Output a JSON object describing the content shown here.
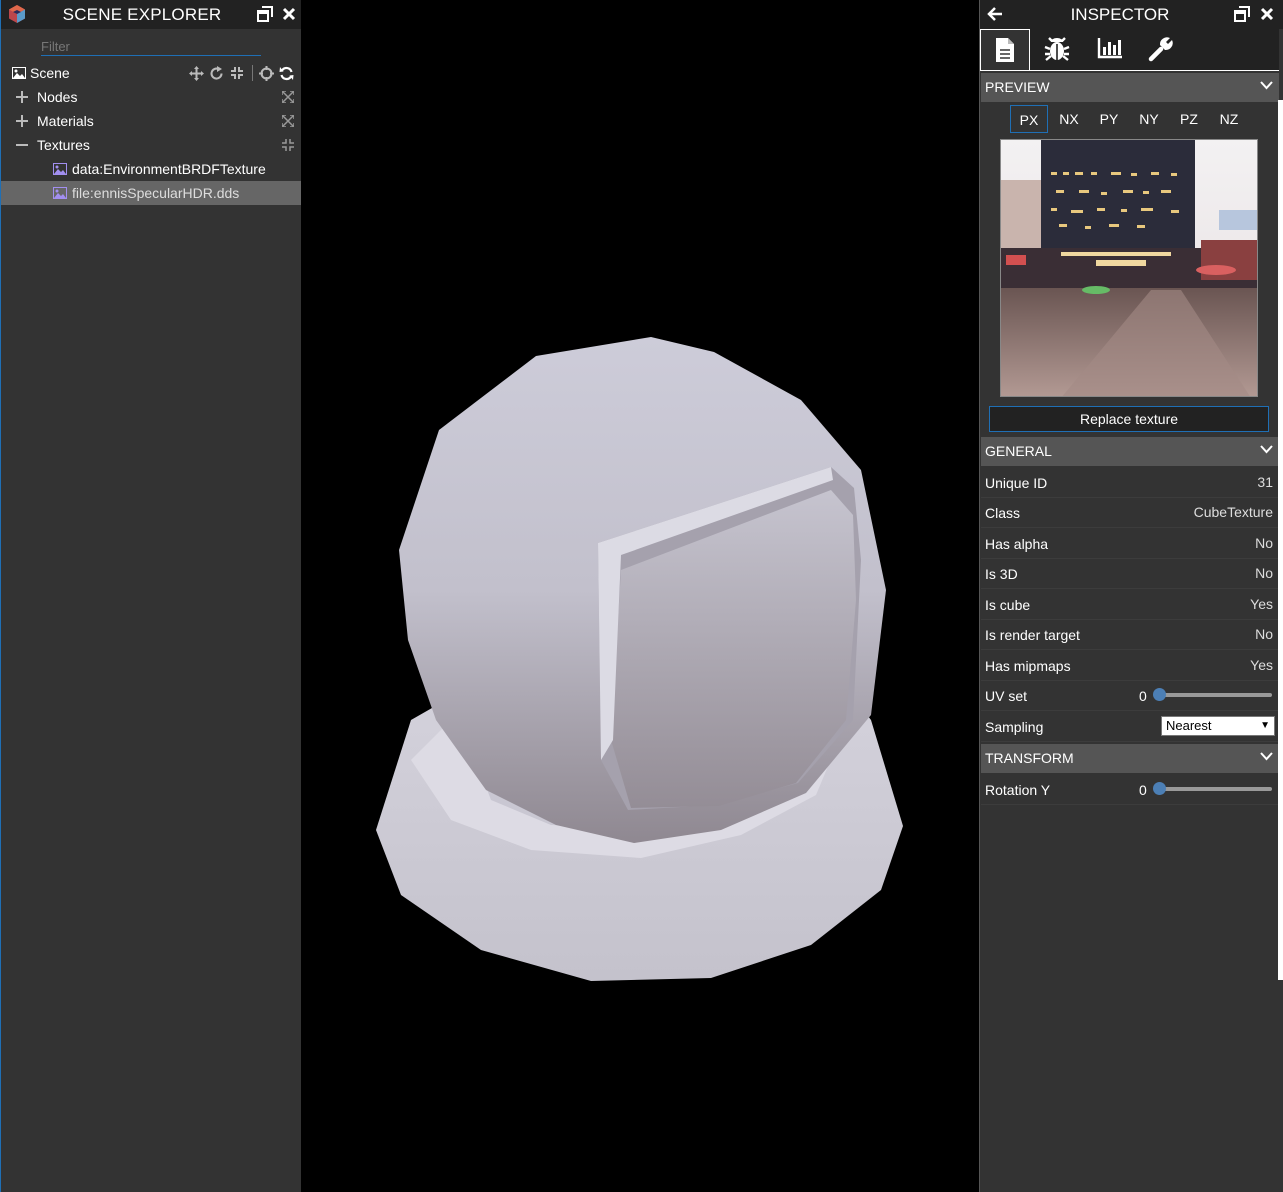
{
  "explorer": {
    "title": "SCENE EXPLORER",
    "filter_placeholder": "Filter",
    "scene_label": "Scene",
    "tree": [
      {
        "label": "Nodes",
        "expanded": false
      },
      {
        "label": "Materials",
        "expanded": false
      },
      {
        "label": "Textures",
        "expanded": true
      }
    ],
    "textures": [
      {
        "label": "data:EnvironmentBRDFTexture",
        "selected": false
      },
      {
        "label": "file:ennisSpecularHDR.dds",
        "selected": true
      }
    ]
  },
  "inspector": {
    "title": "INSPECTOR",
    "tabs": [
      {
        "icon": "document-icon",
        "active": true
      },
      {
        "icon": "bug-icon",
        "active": false
      },
      {
        "icon": "statistics-icon",
        "active": false
      },
      {
        "icon": "wrench-icon",
        "active": false
      }
    ],
    "preview": {
      "header": "PREVIEW",
      "faces": [
        "PX",
        "NX",
        "PY",
        "NY",
        "PZ",
        "NZ"
      ],
      "active_face": "PX",
      "replace_label": "Replace texture"
    },
    "general": {
      "header": "GENERAL",
      "rows": [
        {
          "label": "Unique ID",
          "value": "31"
        },
        {
          "label": "Class",
          "value": "CubeTexture"
        },
        {
          "label": "Has alpha",
          "value": "No"
        },
        {
          "label": "Is 3D",
          "value": "No"
        },
        {
          "label": "Is cube",
          "value": "Yes"
        },
        {
          "label": "Is render target",
          "value": "No"
        },
        {
          "label": "Has mipmaps",
          "value": "Yes"
        }
      ],
      "uv_set": {
        "label": "UV set",
        "value": "0"
      },
      "sampling": {
        "label": "Sampling",
        "value": "Nearest"
      }
    },
    "transform": {
      "header": "TRANSFORM",
      "rotation_y": {
        "label": "Rotation Y",
        "value": "0"
      }
    }
  },
  "colors": {
    "accent": "#1f6fb5",
    "panel": "#333333",
    "header": "#222222",
    "section": "#555555",
    "selected_row": "#666666",
    "slider_thumb": "#4c7fb5"
  }
}
